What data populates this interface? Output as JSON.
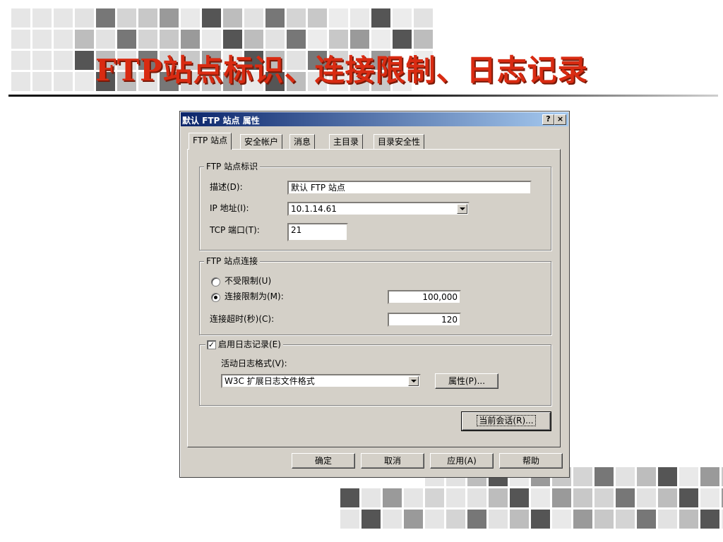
{
  "slide": {
    "title": "FTP站点标识、连接限制、日志记录",
    "tile_colors": [
      "#e9e9e9",
      "#d4d4d4",
      "#bdbdbd",
      "#9a9a9a",
      "#777777",
      "#555555",
      "#c8c8c8",
      "#e2e2e2"
    ]
  },
  "window": {
    "title": "默认 FTP 站点 属性",
    "help_label": "?",
    "close_label": "×"
  },
  "tabs": [
    {
      "label": "FTP 站点",
      "active": true
    },
    {
      "label": "安全帐户"
    },
    {
      "label": "消息"
    },
    {
      "label": "主目录"
    },
    {
      "label": "目录安全性"
    }
  ],
  "identification": {
    "legend": "FTP 站点标识",
    "description_label": "描述(D):",
    "description_value": "默认 FTP 站点",
    "ip_label": "IP 地址(I):",
    "ip_value": "10.1.14.61",
    "port_label": "TCP 端口(T):",
    "port_value": "21"
  },
  "connections": {
    "legend": "FTP 站点连接",
    "unlimited_label": "不受限制(U)",
    "unlimited_selected": false,
    "limited_label": "连接限制为(M):",
    "limited_selected": true,
    "limit_value": "100,000",
    "timeout_label": "连接超时(秒)(C):",
    "timeout_value": "120"
  },
  "logging": {
    "enable_label": "启用日志记录(E)",
    "enabled": true,
    "check_mark": "✓",
    "format_label": "活动日志格式(V):",
    "format_value": "W3C 扩展日志文件格式",
    "properties_button": "属性(P)..."
  },
  "current_sessions_button": "当前会话(R)...",
  "footer": {
    "ok": "确定",
    "cancel": "取消",
    "apply": "应用(A)",
    "help": "帮助"
  }
}
